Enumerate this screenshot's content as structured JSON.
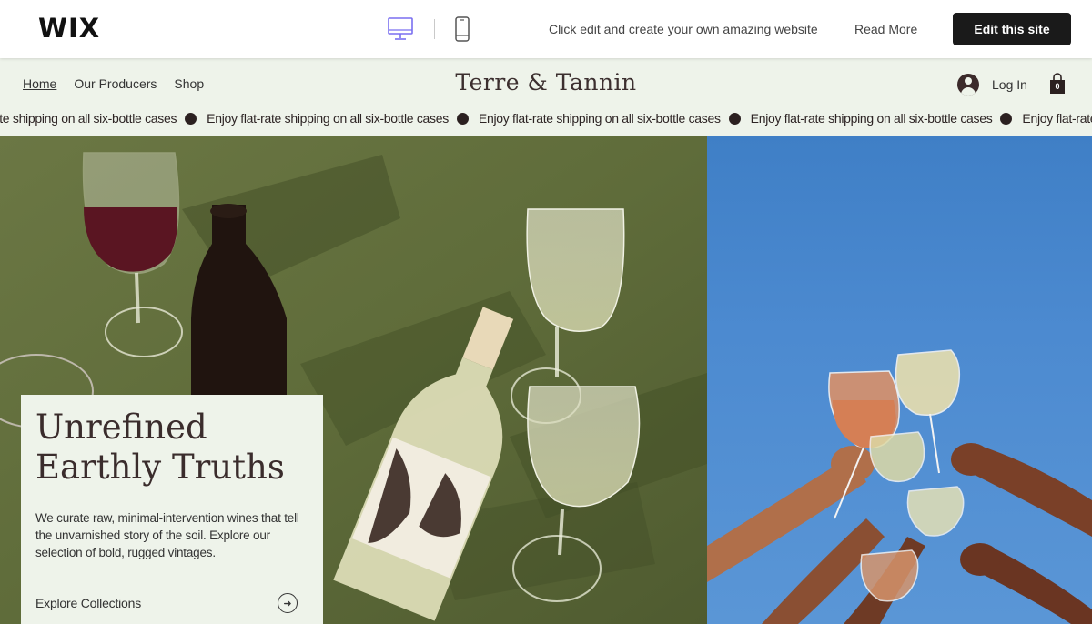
{
  "wix_bar": {
    "logo": "WIX",
    "message": "Click edit and create your own amazing website",
    "read_more": "Read More",
    "edit_button": "Edit this site"
  },
  "header": {
    "nav": [
      "Home",
      "Our Producers",
      "Shop"
    ],
    "brand": "Terre & Tannin",
    "login": "Log In",
    "cart_count": "0"
  },
  "ticker": {
    "items": [
      "-rate shipping on all six-bottle cases",
      "Enjoy flat-rate shipping on all six-bottle cases",
      "Enjoy flat-rate shipping on all six-bottle cases",
      "Enjoy flat-rate shipping on all six-bottle cases",
      "Enjoy flat-rate s"
    ]
  },
  "hero": {
    "title_line1": "Unrefined",
    "title_line2": "Earthly Truths",
    "body": "We curate raw, minimal-intervention wines that tell the unvarnished story of the soil. Explore our selection of bold, rugged vintages.",
    "link": "Explore Collections"
  },
  "colors": {
    "accent_dark": "#1a1a1a",
    "header_bg": "#eef3ea",
    "brand_text": "#3c2f2f",
    "hero_olive": "#5c6a3a",
    "sky_blue": "#4c8ad0"
  },
  "icons": {
    "desktop": "desktop-icon",
    "mobile": "mobile-icon",
    "avatar": "user-avatar-icon",
    "cart": "shopping-bag-icon",
    "arrow": "arrow-right-icon"
  }
}
